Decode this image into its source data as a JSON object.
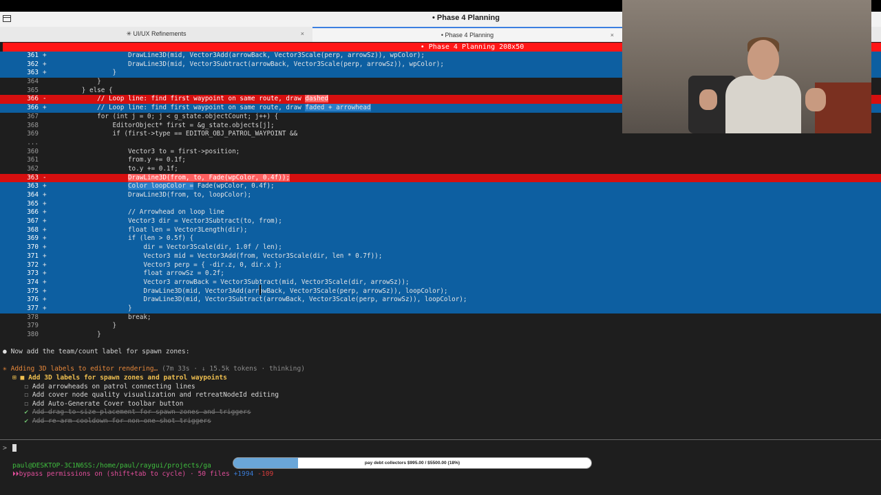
{
  "window": {
    "title": "• Phase 4 Planning"
  },
  "tabs": [
    {
      "label": "✳ UI/UX Refinements",
      "close": "×"
    },
    {
      "label": "• Phase 4 Planning",
      "close": "×"
    }
  ],
  "status_bar": {
    "text": "• Phase 4 Planning 208x50"
  },
  "diff": [
    {
      "num": "361",
      "sign": "+",
      "type": "add",
      "code": "                    DrawLine3D(mid, Vector3Add(arrowBack, Vector3Scale(perp, arrowSz)), wpColor);"
    },
    {
      "num": "362",
      "sign": "+",
      "type": "add",
      "code": "                    DrawLine3D(mid, Vector3Subtract(arrowBack, Vector3Scale(perp, arrowSz)), wpColor);"
    },
    {
      "num": "363",
      "sign": "+",
      "type": "add",
      "code": "                }"
    },
    {
      "num": "364",
      "sign": " ",
      "type": "ctx",
      "code": "            }"
    },
    {
      "num": "365",
      "sign": " ",
      "type": "ctx",
      "code": "        } else {"
    },
    {
      "num": "366",
      "sign": "-",
      "type": "del",
      "code": "            // Loop line: find first waypoint on same route, draw ",
      "hl": "dashed"
    },
    {
      "num": "366",
      "sign": "+",
      "type": "add",
      "code": "            // Loop line: find first waypoint on same route, draw ",
      "hl": "faded + arrowhead"
    },
    {
      "num": "367",
      "sign": " ",
      "type": "ctx",
      "code": "            for (int j = 0; j < g_state.objectCount; j++) {"
    },
    {
      "num": "368",
      "sign": " ",
      "type": "ctx",
      "code": "                EditorObject* first = &g_state.objects[j];"
    },
    {
      "num": "369",
      "sign": " ",
      "type": "ctx",
      "code": "                if (first->type == EDITOR_OBJ_PATROL_WAYPOINT &&"
    },
    {
      "num": "...",
      "sign": " ",
      "type": "ctx",
      "code": ""
    },
    {
      "num": "360",
      "sign": " ",
      "type": "ctx",
      "code": "                    Vector3 to = first->position;"
    },
    {
      "num": "361",
      "sign": " ",
      "type": "ctx",
      "code": "                    from.y += 0.1f;"
    },
    {
      "num": "362",
      "sign": " ",
      "type": "ctx",
      "code": "                    to.y += 0.1f;"
    },
    {
      "num": "363",
      "sign": "-",
      "type": "del",
      "code": "                    ",
      "hl": "DrawLine3D(from, to, Fade(wpColor, 0.4f));"
    },
    {
      "num": "363",
      "sign": "+",
      "type": "add",
      "code": "                    ",
      "hl": "Color loopColor =",
      "tail": " Fade(wpColor, 0.4f);"
    },
    {
      "num": "364",
      "sign": "+",
      "type": "add",
      "code": "                    DrawLine3D(from, to, loopColor);"
    },
    {
      "num": "365",
      "sign": "+",
      "type": "add",
      "code": ""
    },
    {
      "num": "366",
      "sign": "+",
      "type": "add",
      "code": "                    // Arrowhead on loop line"
    },
    {
      "num": "367",
      "sign": "+",
      "type": "add",
      "code": "                    Vector3 dir = Vector3Subtract(to, from);"
    },
    {
      "num": "368",
      "sign": "+",
      "type": "add",
      "code": "                    float len = Vector3Length(dir);"
    },
    {
      "num": "369",
      "sign": "+",
      "type": "add",
      "code": "                    if (len > 0.5f) {"
    },
    {
      "num": "370",
      "sign": "+",
      "type": "add",
      "code": "                        dir = Vector3Scale(dir, 1.0f / len);"
    },
    {
      "num": "371",
      "sign": "+",
      "type": "add",
      "code": "                        Vector3 mid = Vector3Add(from, Vector3Scale(dir, len * 0.7f));"
    },
    {
      "num": "372",
      "sign": "+",
      "type": "add",
      "code": "                        Vector3 perp = { -dir.z, 0, dir.x };"
    },
    {
      "num": "373",
      "sign": "+",
      "type": "add",
      "code": "                        float arrowSz = 0.2f;"
    },
    {
      "num": "374",
      "sign": "+",
      "type": "add",
      "code": "                        Vector3 arrowBack = Vector3Subtract(mid, Vector3Scale(dir, arrowSz));"
    },
    {
      "num": "375",
      "sign": "+",
      "type": "add",
      "code": "                        DrawLine3D(mid, Vector3Add(arrowBack, Vector3Scale(perp, arrowSz)), loopColor);"
    },
    {
      "num": "376",
      "sign": "+",
      "type": "add",
      "code": "                        DrawLine3D(mid, Vector3Subtract(arrowBack, Vector3Scale(perp, arrowSz)), loopColor);"
    },
    {
      "num": "377",
      "sign": "+",
      "type": "add",
      "code": "                    }"
    },
    {
      "num": "378",
      "sign": " ",
      "type": "ctx",
      "code": "                    break;"
    },
    {
      "num": "379",
      "sign": " ",
      "type": "ctx",
      "code": "                }"
    },
    {
      "num": "380",
      "sign": " ",
      "type": "ctx",
      "code": "            }"
    }
  ],
  "chat": {
    "message": "Now add the team/count label for spawn zones:",
    "activity": "Adding 3D labels to editor rendering…",
    "activity_meta": "(7m 33s · ↓ 15.5k tokens · thinking)",
    "todos": [
      {
        "state": "active",
        "label": "Add 3D labels for spawn zones and patrol waypoints"
      },
      {
        "state": "pending",
        "label": "Add arrowheads on patrol connecting lines"
      },
      {
        "state": "pending",
        "label": "Add cover node quality visualization and retreatNodeId editing"
      },
      {
        "state": "pending",
        "label": "Add Auto-Generate Cover toolbar button"
      },
      {
        "state": "done",
        "label": "Add drag-to-size placement for spawn zones and triggers"
      },
      {
        "state": "done",
        "label": "Add re-arm cooldown for non-one-shot triggers"
      }
    ]
  },
  "prompt": {
    "symbol": ">"
  },
  "footer": {
    "cwd": "paul@DESKTOP-3C1N6SS:/home/paul/raygui/projects/ga",
    "permissions": "⏵⏵bypass permissions on (shift+tab to cycle) · 50 files",
    "lines_added": "+1994",
    "lines_removed": "-109"
  },
  "donation": {
    "text": "pay debt collectors $995.00 / $5500.00 (18%)",
    "progress": 0.18
  },
  "colors": {
    "added_bg": "#0d5fa1",
    "removed_bg": "#d60f0f",
    "status_red": "#ff1616"
  }
}
